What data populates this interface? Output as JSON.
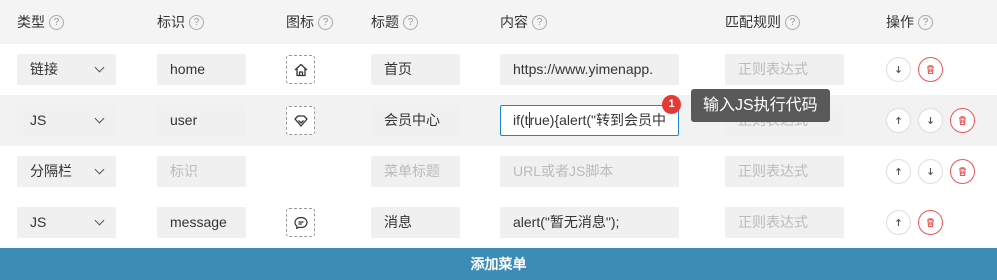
{
  "columns": {
    "type": "类型",
    "key": "标识",
    "icon": "图标",
    "title": "标题",
    "content": "内容",
    "match_rule": "匹配规则",
    "actions": "操作"
  },
  "help_glyph": "?",
  "rows": [
    {
      "type": "链接",
      "key": "home",
      "icon": "home-icon",
      "title": "首页",
      "content": "https://www.yimenapp.",
      "match_rule_placeholder": "正则表达式"
    },
    {
      "type": "JS",
      "key": "user",
      "icon": "diamond-icon",
      "title": "会员中心",
      "content_before_cursor": "if(t",
      "content_after_cursor": "rue){alert(\"转到会员中",
      "match_rule_placeholder": "正则表达式"
    },
    {
      "type": "分隔栏",
      "key_placeholder": "标识",
      "title_placeholder": "菜单标题",
      "content_placeholder": "URL或者JS脚本",
      "match_rule_placeholder": "正则表达式"
    },
    {
      "type": "JS",
      "key": "message",
      "icon": "chat-icon",
      "title": "消息",
      "content": "alert(\"暂无消息\");",
      "match_rule_placeholder": "正则表达式"
    }
  ],
  "callout": {
    "step": "1",
    "text": "输入JS执行代码"
  },
  "add_button_label": "添加菜单",
  "colors": {
    "accent": "#3d8cb8",
    "focus_border": "#1e88c7",
    "delete_red": "#e55555",
    "badge_red": "#e53935",
    "tooltip_bg": "#595959"
  }
}
